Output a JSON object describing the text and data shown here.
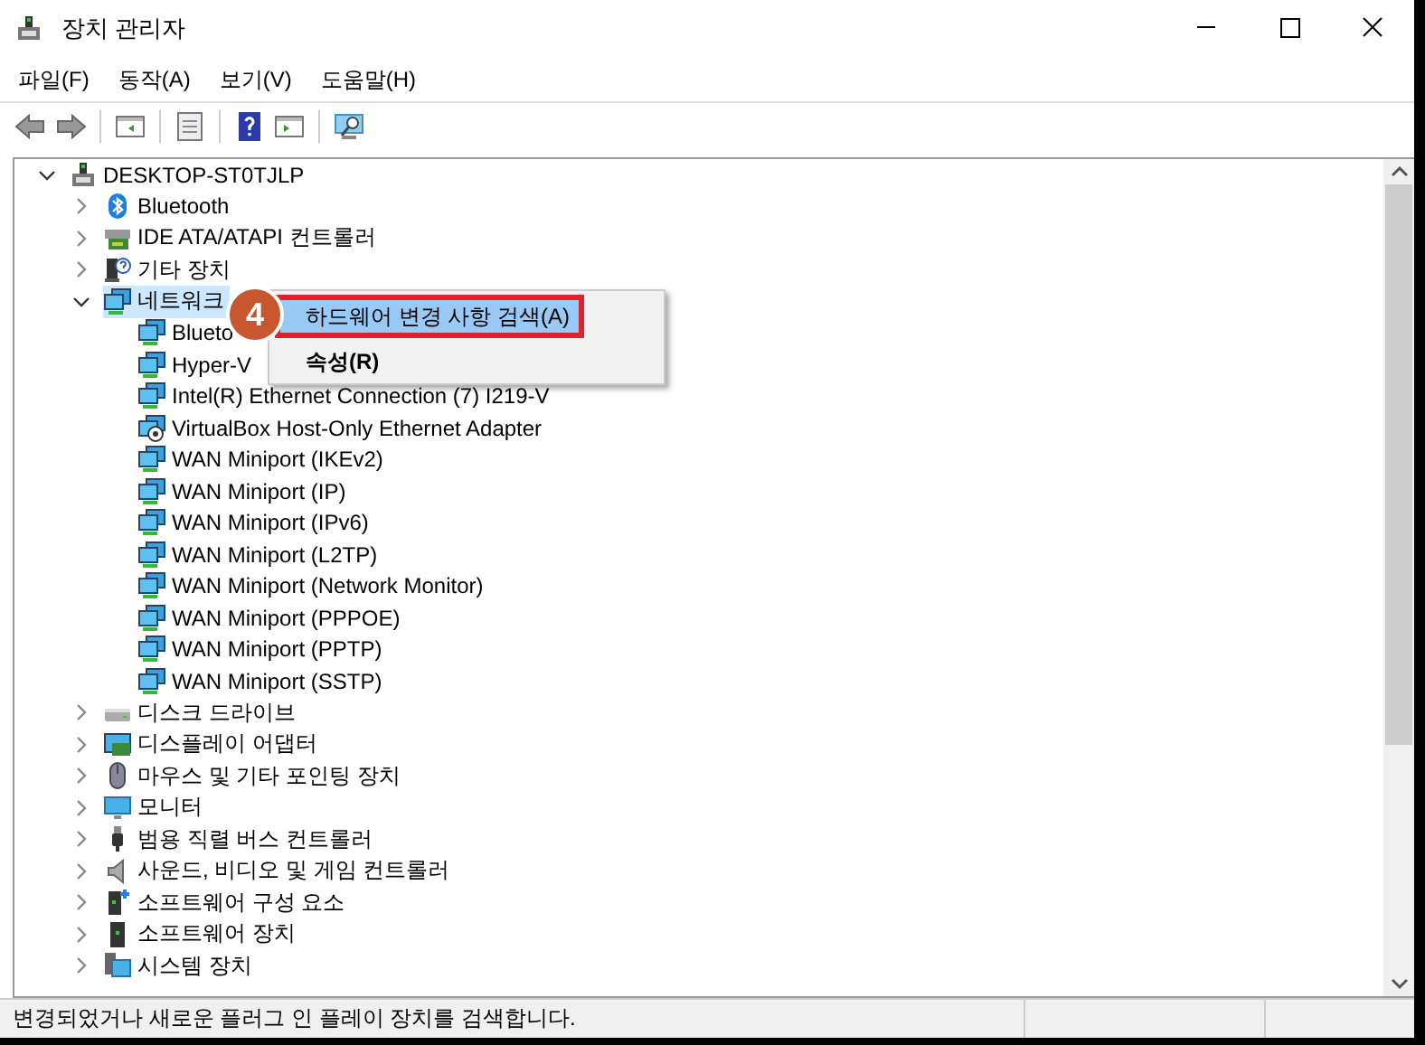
{
  "window": {
    "title": "장치 관리자"
  },
  "menu": [
    "파일(F)",
    "동작(A)",
    "보기(V)",
    "도움말(H)"
  ],
  "tree": {
    "label": "DESKTOP-ST0TJLP",
    "kind": "computer",
    "expanded": true,
    "selected": false,
    "children": [
      {
        "label": "Bluetooth",
        "kind": "bluetooth",
        "expanded": false,
        "selected": false
      },
      {
        "label": "IDE ATA/ATAPI 컨트롤러",
        "kind": "controller",
        "expanded": false,
        "selected": false
      },
      {
        "label": "기타 장치",
        "kind": "unknown",
        "expanded": false,
        "selected": false
      },
      {
        "label": "네트워크",
        "kind": "network",
        "expanded": true,
        "selected": true,
        "children": [
          {
            "label": "Blueto",
            "kind": "network",
            "selected": false
          },
          {
            "label": "Hyper-V",
            "kind": "network",
            "selected": false
          },
          {
            "label": "Intel(R) Ethernet Connection (7) I219-V",
            "kind": "network",
            "selected": false
          },
          {
            "label": "VirtualBox Host-Only Ethernet Adapter",
            "kind": "virtual",
            "selected": false
          },
          {
            "label": "WAN Miniport (IKEv2)",
            "kind": "network",
            "selected": false
          },
          {
            "label": "WAN Miniport (IP)",
            "kind": "network",
            "selected": false
          },
          {
            "label": "WAN Miniport (IPv6)",
            "kind": "network",
            "selected": false
          },
          {
            "label": "WAN Miniport (L2TP)",
            "kind": "network",
            "selected": false
          },
          {
            "label": "WAN Miniport (Network Monitor)",
            "kind": "network",
            "selected": false
          },
          {
            "label": "WAN Miniport (PPPOE)",
            "kind": "network",
            "selected": false
          },
          {
            "label": "WAN Miniport (PPTP)",
            "kind": "network",
            "selected": false
          },
          {
            "label": "WAN Miniport (SSTP)",
            "kind": "network",
            "selected": false
          }
        ]
      },
      {
        "label": "디스크 드라이브",
        "kind": "disk",
        "expanded": false,
        "selected": false
      },
      {
        "label": "디스플레이 어댑터",
        "kind": "display",
        "expanded": false,
        "selected": false
      },
      {
        "label": "마우스 및 기타 포인팅 장치",
        "kind": "mouse",
        "expanded": false,
        "selected": false
      },
      {
        "label": "모니터",
        "kind": "monitor",
        "expanded": false,
        "selected": false
      },
      {
        "label": "범용 직렬 버스 컨트롤러",
        "kind": "usb",
        "expanded": false,
        "selected": false
      },
      {
        "label": "사운드, 비디오 및 게임 컨트롤러",
        "kind": "sound",
        "expanded": false,
        "selected": false
      },
      {
        "label": "소프트웨어 구성 요소",
        "kind": "component",
        "expanded": false,
        "selected": false
      },
      {
        "label": "소프트웨어 장치",
        "kind": "device",
        "expanded": false,
        "selected": false
      },
      {
        "label": "시스템 장치",
        "kind": "system",
        "expanded": false,
        "selected": false
      }
    ]
  },
  "context_menu": {
    "items": [
      {
        "label": "하드웨어 변경 사항 검색(A)",
        "selected": true,
        "bold": false,
        "outlined": true
      },
      {
        "label": "속성(R)",
        "selected": false,
        "bold": true,
        "outlined": false
      }
    ]
  },
  "step_badge": "4",
  "status_bar": {
    "text": "변경되었거나 새로운 플러그 인 플레이 장치를 검색합니다."
  }
}
